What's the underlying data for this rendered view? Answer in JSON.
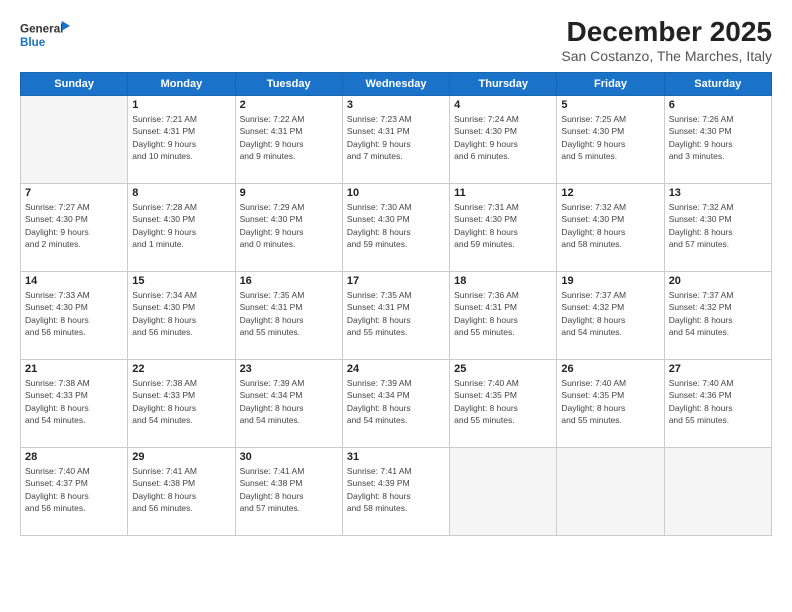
{
  "logo": {
    "line1": "General",
    "line2": "Blue"
  },
  "header": {
    "month": "December 2025",
    "location": "San Costanzo, The Marches, Italy"
  },
  "columns": [
    "Sunday",
    "Monday",
    "Tuesday",
    "Wednesday",
    "Thursday",
    "Friday",
    "Saturday"
  ],
  "weeks": [
    [
      {
        "day": "",
        "info": ""
      },
      {
        "day": "1",
        "info": "Sunrise: 7:21 AM\nSunset: 4:31 PM\nDaylight: 9 hours\nand 10 minutes."
      },
      {
        "day": "2",
        "info": "Sunrise: 7:22 AM\nSunset: 4:31 PM\nDaylight: 9 hours\nand 9 minutes."
      },
      {
        "day": "3",
        "info": "Sunrise: 7:23 AM\nSunset: 4:31 PM\nDaylight: 9 hours\nand 7 minutes."
      },
      {
        "day": "4",
        "info": "Sunrise: 7:24 AM\nSunset: 4:30 PM\nDaylight: 9 hours\nand 6 minutes."
      },
      {
        "day": "5",
        "info": "Sunrise: 7:25 AM\nSunset: 4:30 PM\nDaylight: 9 hours\nand 5 minutes."
      },
      {
        "day": "6",
        "info": "Sunrise: 7:26 AM\nSunset: 4:30 PM\nDaylight: 9 hours\nand 3 minutes."
      }
    ],
    [
      {
        "day": "7",
        "info": "Sunrise: 7:27 AM\nSunset: 4:30 PM\nDaylight: 9 hours\nand 2 minutes."
      },
      {
        "day": "8",
        "info": "Sunrise: 7:28 AM\nSunset: 4:30 PM\nDaylight: 9 hours\nand 1 minute."
      },
      {
        "day": "9",
        "info": "Sunrise: 7:29 AM\nSunset: 4:30 PM\nDaylight: 9 hours\nand 0 minutes."
      },
      {
        "day": "10",
        "info": "Sunrise: 7:30 AM\nSunset: 4:30 PM\nDaylight: 8 hours\nand 59 minutes."
      },
      {
        "day": "11",
        "info": "Sunrise: 7:31 AM\nSunset: 4:30 PM\nDaylight: 8 hours\nand 59 minutes."
      },
      {
        "day": "12",
        "info": "Sunrise: 7:32 AM\nSunset: 4:30 PM\nDaylight: 8 hours\nand 58 minutes."
      },
      {
        "day": "13",
        "info": "Sunrise: 7:32 AM\nSunset: 4:30 PM\nDaylight: 8 hours\nand 57 minutes."
      }
    ],
    [
      {
        "day": "14",
        "info": "Sunrise: 7:33 AM\nSunset: 4:30 PM\nDaylight: 8 hours\nand 56 minutes."
      },
      {
        "day": "15",
        "info": "Sunrise: 7:34 AM\nSunset: 4:30 PM\nDaylight: 8 hours\nand 56 minutes."
      },
      {
        "day": "16",
        "info": "Sunrise: 7:35 AM\nSunset: 4:31 PM\nDaylight: 8 hours\nand 55 minutes."
      },
      {
        "day": "17",
        "info": "Sunrise: 7:35 AM\nSunset: 4:31 PM\nDaylight: 8 hours\nand 55 minutes."
      },
      {
        "day": "18",
        "info": "Sunrise: 7:36 AM\nSunset: 4:31 PM\nDaylight: 8 hours\nand 55 minutes."
      },
      {
        "day": "19",
        "info": "Sunrise: 7:37 AM\nSunset: 4:32 PM\nDaylight: 8 hours\nand 54 minutes."
      },
      {
        "day": "20",
        "info": "Sunrise: 7:37 AM\nSunset: 4:32 PM\nDaylight: 8 hours\nand 54 minutes."
      }
    ],
    [
      {
        "day": "21",
        "info": "Sunrise: 7:38 AM\nSunset: 4:33 PM\nDaylight: 8 hours\nand 54 minutes."
      },
      {
        "day": "22",
        "info": "Sunrise: 7:38 AM\nSunset: 4:33 PM\nDaylight: 8 hours\nand 54 minutes."
      },
      {
        "day": "23",
        "info": "Sunrise: 7:39 AM\nSunset: 4:34 PM\nDaylight: 8 hours\nand 54 minutes."
      },
      {
        "day": "24",
        "info": "Sunrise: 7:39 AM\nSunset: 4:34 PM\nDaylight: 8 hours\nand 54 minutes."
      },
      {
        "day": "25",
        "info": "Sunrise: 7:40 AM\nSunset: 4:35 PM\nDaylight: 8 hours\nand 55 minutes."
      },
      {
        "day": "26",
        "info": "Sunrise: 7:40 AM\nSunset: 4:35 PM\nDaylight: 8 hours\nand 55 minutes."
      },
      {
        "day": "27",
        "info": "Sunrise: 7:40 AM\nSunset: 4:36 PM\nDaylight: 8 hours\nand 55 minutes."
      }
    ],
    [
      {
        "day": "28",
        "info": "Sunrise: 7:40 AM\nSunset: 4:37 PM\nDaylight: 8 hours\nand 56 minutes."
      },
      {
        "day": "29",
        "info": "Sunrise: 7:41 AM\nSunset: 4:38 PM\nDaylight: 8 hours\nand 56 minutes."
      },
      {
        "day": "30",
        "info": "Sunrise: 7:41 AM\nSunset: 4:38 PM\nDaylight: 8 hours\nand 57 minutes."
      },
      {
        "day": "31",
        "info": "Sunrise: 7:41 AM\nSunset: 4:39 PM\nDaylight: 8 hours\nand 58 minutes."
      },
      {
        "day": "",
        "info": ""
      },
      {
        "day": "",
        "info": ""
      },
      {
        "day": "",
        "info": ""
      }
    ]
  ]
}
